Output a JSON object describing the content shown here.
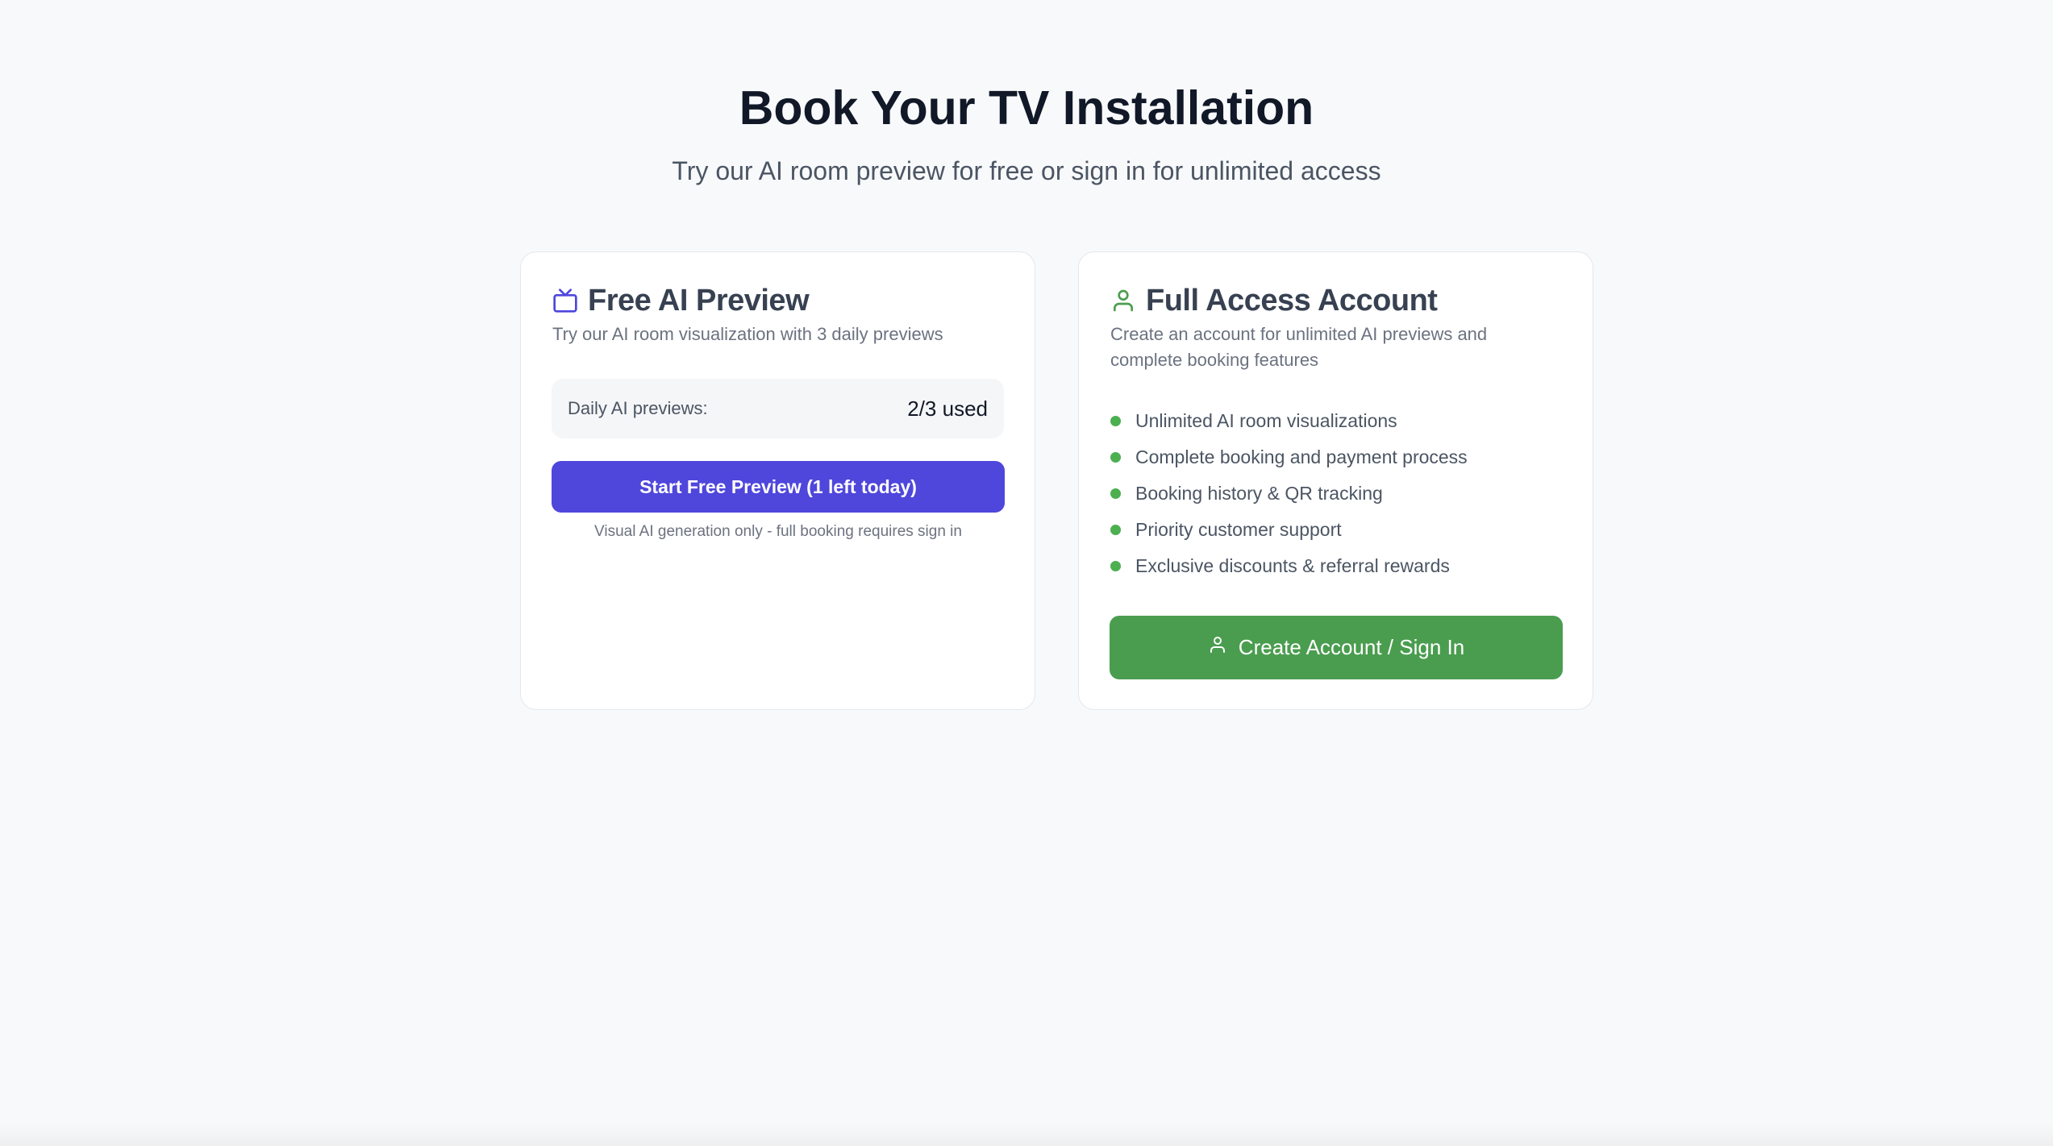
{
  "header": {
    "title": "Book Your TV Installation",
    "subtitle": "Try our AI room preview for free or sign in for unlimited access"
  },
  "free_card": {
    "icon": "tv-icon",
    "title": "Free AI Preview",
    "description": "Try our AI room visualization with 3 daily previews",
    "usage_label": "Daily AI previews:",
    "usage_value": "2/3 used",
    "button_label": "Start Free Preview (1 left today)",
    "note": "Visual AI generation only - full booking requires sign in",
    "accent_color": "#4f46dc"
  },
  "full_card": {
    "icon": "user-icon",
    "title": "Full Access Account",
    "description": "Create an account for unlimited AI previews and complete booking features",
    "features": [
      "Unlimited AI room visualizations",
      "Complete booking and payment process",
      "Booking history & QR tracking",
      "Priority customer support",
      "Exclusive discounts & referral rewards"
    ],
    "button_label": "Create Account / Sign In",
    "accent_color": "#4a9d4f"
  }
}
